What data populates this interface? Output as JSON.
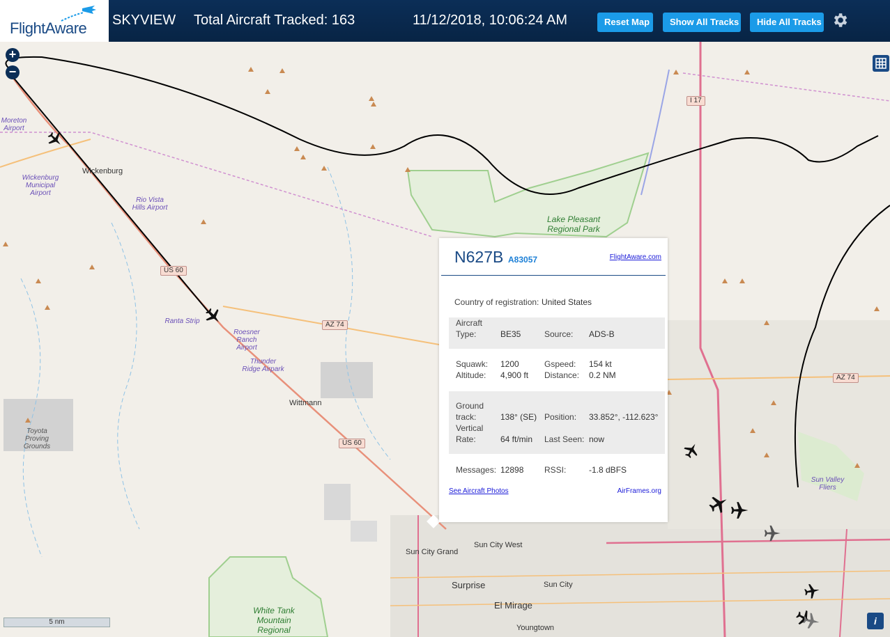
{
  "header": {
    "logo_text": "FlightAware",
    "app_name": "SKYVIEW",
    "total_tracked_label": "Total Aircraft Tracked: 163",
    "datetime": "11/12/2018, 10:06:24 AM",
    "reset_map_label": "Reset Map",
    "show_all_tracks_label": "Show All Tracks",
    "hide_all_tracks_label": "Hide All Tracks",
    "settings_icon": "gear-icon"
  },
  "map": {
    "zoom_in_label": "+",
    "zoom_out_label": "−",
    "scale_label": "5 nm",
    "info_label": "i",
    "airports": [
      "Moreton Airport",
      "Wickenburg Municipal Airport",
      "Rio Vista Hills Airport",
      "Ranta Strip",
      "Roesner Ranch Airport",
      "Thunder Ridge Airpark",
      "Sun Valley Fliers"
    ],
    "towns": [
      "Wickenburg",
      "Wittmann",
      "Sun City West",
      "Sun City Grand",
      "Surprise",
      "Sun City",
      "El Mirage",
      "Youngtown"
    ],
    "parks": [
      "Lake Pleasant Regional Park",
      "White Tank Mountain Regional",
      "Toyota Proving Grounds"
    ],
    "roads": [
      "US 60",
      "AZ 74",
      "I 17",
      "US 60",
      "AZ 74"
    ]
  },
  "popup": {
    "registration": "N627B",
    "hex_code": "A83057",
    "flightaware_link": "FlightAware.com",
    "country_label": "Country of registration:",
    "country_value": "United States",
    "aircraft_type_label_1": "Aircraft",
    "aircraft_type_label_2": "Type:",
    "aircraft_type_value": "BE35",
    "source_label": "Source:",
    "source_value": "ADS-B",
    "squawk_label": "Squawk:",
    "squawk_value": "1200",
    "gspeed_label": "Gspeed:",
    "gspeed_value": "154 kt",
    "altitude_label": "Altitude:",
    "altitude_value": "4,900 ft",
    "distance_label": "Distance:",
    "distance_value": "0.2 NM",
    "ground_track_label_1": "Ground",
    "ground_track_label_2": "track:",
    "ground_track_value": "138° (SE)",
    "position_label": "Position:",
    "position_value": "33.852°, -112.623°",
    "vrate_label_1": "Vertical",
    "vrate_label_2": "Rate:",
    "vrate_value": "64 ft/min",
    "last_seen_label": "Last Seen:",
    "last_seen_value": "now",
    "messages_label": "Messages:",
    "messages_value": "12898",
    "rssi_label": "RSSI:",
    "rssi_value": "-1.8 dBFS",
    "photos_link": "See Aircraft Photos",
    "airframes_link": "AirFrames.org"
  }
}
